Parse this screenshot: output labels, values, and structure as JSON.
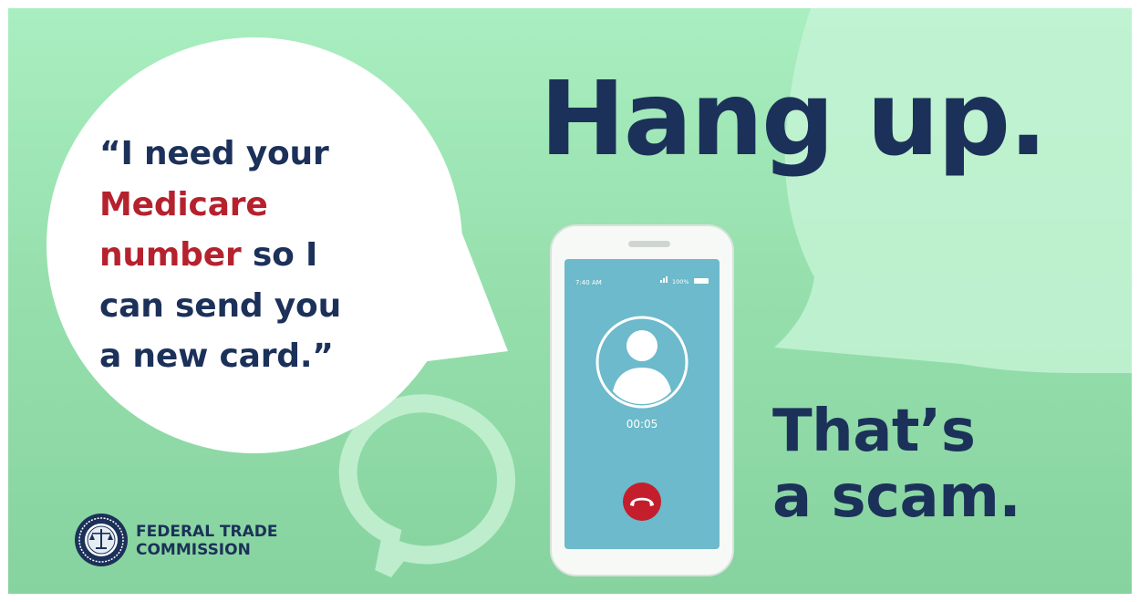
{
  "quote": {
    "line1": "“I need your",
    "line2_red": "Medicare",
    "line3_red": "number",
    "line3_rest": " so I",
    "line4": "can send you",
    "line5": "a new card.”"
  },
  "headline": "Hang up.",
  "tagline": {
    "line1": "That’s",
    "line2": "a scam."
  },
  "phone": {
    "status_time": "7:40 AM",
    "status_battery": "100%",
    "call_timer": "00:05",
    "end_call_icon": "phone-hangup-icon"
  },
  "logo": {
    "line1": "FEDERAL TRADE",
    "line2": "COMMISSION"
  },
  "colors": {
    "background": "#9be3b1",
    "navy": "#1c3159",
    "red": "#b5222e",
    "screen": "#6cbacb"
  }
}
